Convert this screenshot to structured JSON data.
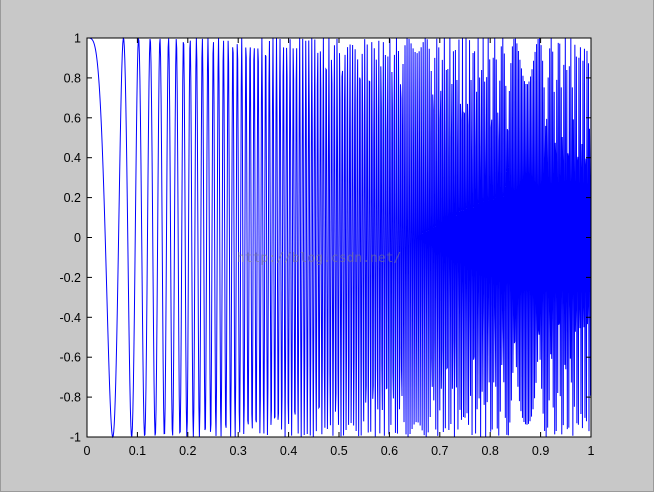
{
  "window": {
    "background": "#c8c8c8"
  },
  "watermark": {
    "text": "http://blog.csdn.net/"
  },
  "chart_data": {
    "type": "line",
    "title": "",
    "xlabel": "",
    "ylabel": "",
    "xlim": [
      0,
      1
    ],
    "ylim": [
      -1,
      1
    ],
    "grid": false,
    "legend": "none",
    "line_color": "#0000ff",
    "axes_background": "#ffffff",
    "x_ticks": [
      0,
      0.1,
      0.2,
      0.3,
      0.4,
      0.5,
      0.6,
      0.7,
      0.8,
      0.9,
      1
    ],
    "x_tick_labels": [
      "0",
      "0.1",
      "0.2",
      "0.3",
      "0.4",
      "0.5",
      "0.6",
      "0.7",
      "0.8",
      "0.9",
      "1"
    ],
    "y_ticks": [
      -1,
      -0.8,
      -0.6,
      -0.4,
      -0.2,
      0,
      0.2,
      0.4,
      0.6,
      0.8,
      1
    ],
    "y_tick_labels": [
      "-1",
      "-0.8",
      "-0.6",
      "-0.4",
      "-0.2",
      "0",
      "0.2",
      "0.4",
      "0.6",
      "0.8",
      "1"
    ],
    "series": [
      {
        "function": "cos",
        "kind": "linear chirp, frequency increasing with x (aliased near x > 0.6)",
        "sample_step": 0.001,
        "phase_coefficient": 1200,
        "amplitude": 1
      }
    ]
  }
}
